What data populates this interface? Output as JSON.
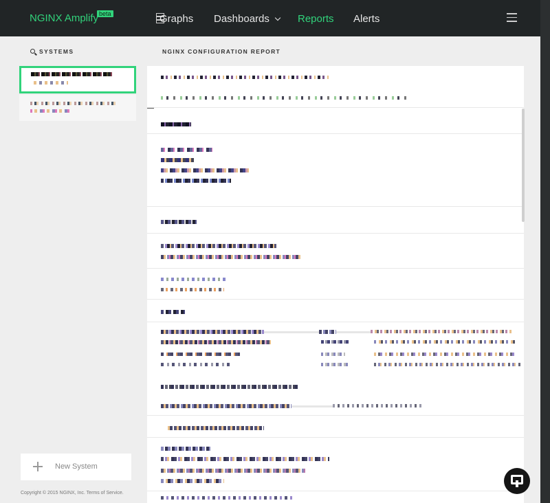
{
  "header": {
    "brand": "NGINX Amplify",
    "badge": "beta",
    "nav": {
      "graphs": "Graphs",
      "dashboards": "Dashboards",
      "reports": "Reports",
      "alerts": "Alerts"
    }
  },
  "sidebar": {
    "title": "SYSTEMS",
    "new_system": "New System",
    "copyright": "Copyright © 2015 NGINX, Inc. Terms of Service."
  },
  "report": {
    "title": "NGINX CONFIGURATION REPORT"
  },
  "colors": {
    "accent": "#31d37b",
    "topbar": "#212526"
  },
  "icons": {
    "search": "search-icon",
    "graphs": "server-icon",
    "menu": "hamburger-menu-icon",
    "add": "plus-icon",
    "chat": "chat-icon"
  }
}
